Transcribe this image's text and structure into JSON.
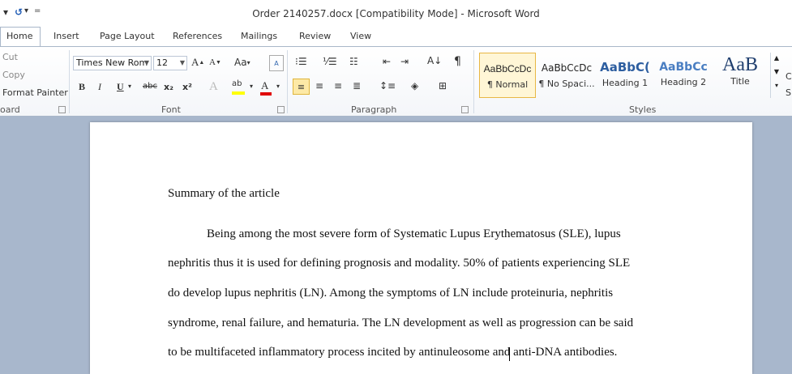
{
  "window": {
    "title": "Order 2140257.docx [Compatibility Mode]  -  Microsoft Word"
  },
  "qat": {
    "more": "="
  },
  "tabs": [
    "Home",
    "Insert",
    "Page Layout",
    "References",
    "Mailings",
    "Review",
    "View"
  ],
  "clipboard": {
    "cut": "Cut",
    "copy": "Copy",
    "format_painter": "Format Painter",
    "label": "oard"
  },
  "font": {
    "name": "Times New Rom",
    "size": "12",
    "grow": "A",
    "shrink": "A",
    "change_case": "Aa",
    "bold": "B",
    "italic": "I",
    "underline": "U",
    "strike": "abc",
    "subscript": "x₂",
    "superscript": "x²",
    "label": "Font",
    "highlight_color": "#ffff00",
    "font_color": "#e00000"
  },
  "paragraph": {
    "label": "Paragraph",
    "pilcrow": "¶"
  },
  "styles": {
    "label": "Styles",
    "items": [
      {
        "preview": "AaBbCcDc",
        "label": "¶ Normal"
      },
      {
        "preview": "AaBbCcDc",
        "label": "¶ No Spaci..."
      },
      {
        "preview": "AaBbC(",
        "label": "Heading 1"
      },
      {
        "preview": "AaBbCc",
        "label": "Heading 2"
      },
      {
        "preview": "AaB",
        "label": "Title"
      }
    ],
    "change_styles": "C",
    "change_styles_sub": "S"
  },
  "document": {
    "heading": "Summary of the article",
    "lines": [
      "Being among the most severe form of Systematic Lupus Erythematosus (SLE), lupus",
      "nephritis thus it is used for defining prognosis and modality. 50% of patients experiencing  SLE",
      "do develop lupus nephritis (LN). Among the symptoms of LN include proteinuria, nephritis",
      "syndrome, renal failure, and hematuria. The LN development as well as progression  can be said",
      "to be multifaceted inflammatory process incited by antinuleosome and anti-DNA antibodies."
    ]
  }
}
